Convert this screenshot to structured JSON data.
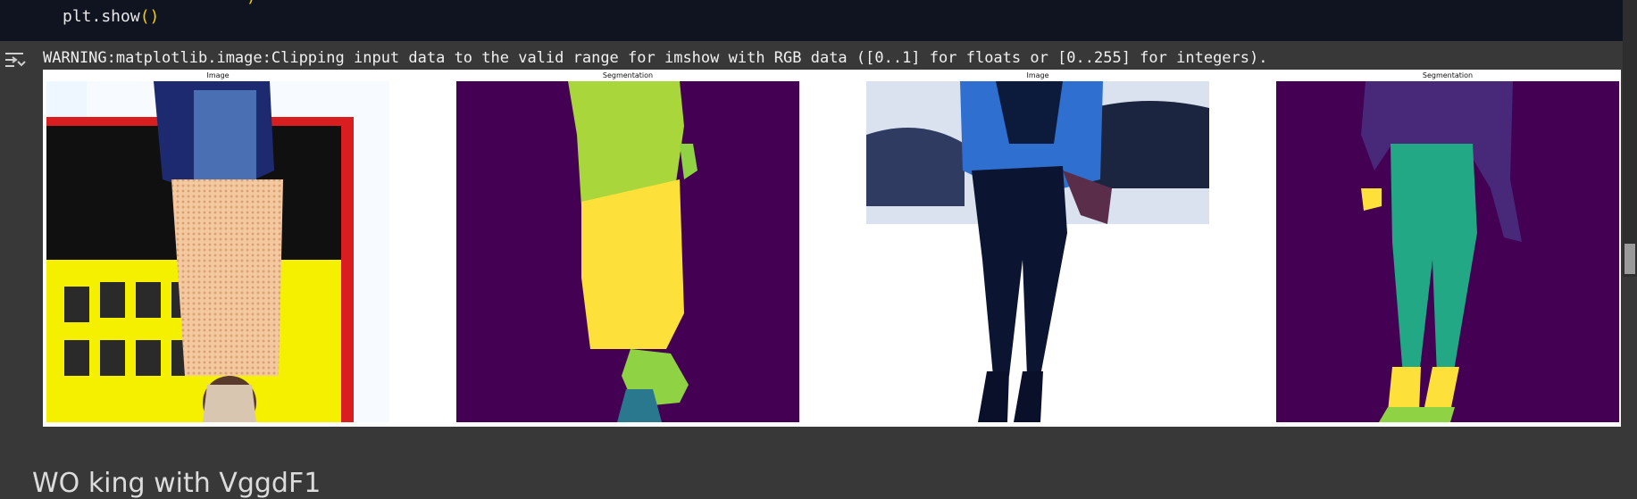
{
  "code_cell": {
    "visible_line": "plt.show",
    "visible_parens": "()"
  },
  "output": {
    "warning_text": "WARNING:matplotlib.image:Clipping input data to the valid range for imshow with RGB data ([0..1] for floats or [0..255] for integers)."
  },
  "figure": {
    "panels": [
      {
        "title": "Image"
      },
      {
        "title": "Segmentation"
      },
      {
        "title": "Image"
      },
      {
        "title": "Segmentation"
      }
    ]
  },
  "next_section": {
    "heading_partial": "WO king with VggdF1"
  },
  "colors": {
    "page_bg": "#383838",
    "code_bg": "#0f1420",
    "segmentation_bg": "#440154",
    "seg_green": "#a9d63a",
    "seg_yellow": "#fde13a",
    "seg_teal": "#22a884",
    "seg_purple": "#482878"
  }
}
